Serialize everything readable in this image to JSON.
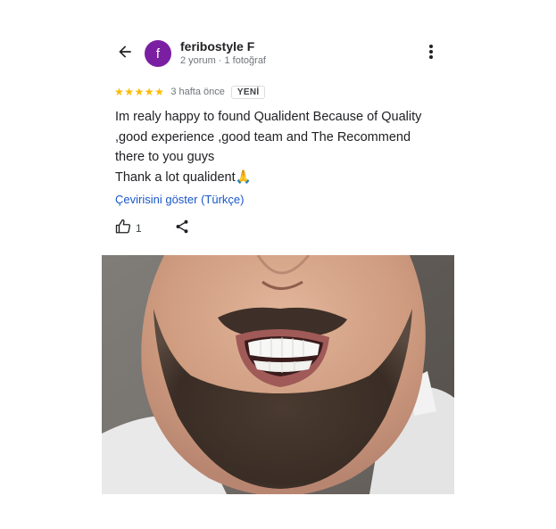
{
  "reviewer": {
    "avatar_letter": "f",
    "name": "feribostyle F",
    "meta": "2 yorum · 1 fotoğraf",
    "avatar_color": "#7b1fa2"
  },
  "icons": {
    "back": "arrow-back-icon",
    "more": "more-vert-icon",
    "like": "thumb-up-icon",
    "share": "share-icon",
    "star": "star-icon"
  },
  "review": {
    "rating": 5,
    "star_glyph": "★",
    "star_color": "#fbbc04",
    "time_ago": "3 hafta önce",
    "badge": "YENİ",
    "text_lines": [
      "Im realy happy to found Qualident Because of Quality",
      ",good experience ,good team and The Recommend",
      "there to you guys",
      "Thank a lot qualident🙏"
    ],
    "translate_link": "Çevirisini göster (Türkçe)",
    "like_count": "1"
  },
  "photo": {
    "description_name": "review-photo"
  }
}
